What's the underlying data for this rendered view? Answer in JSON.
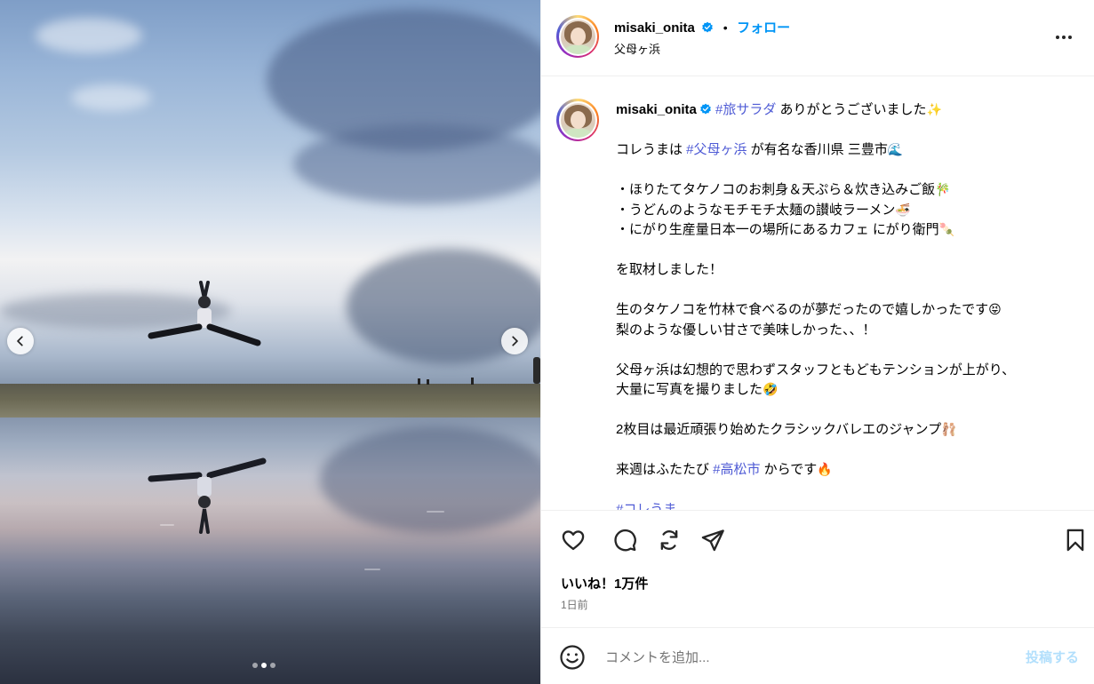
{
  "media": {
    "current_slide": 2,
    "total_slides": 3
  },
  "header": {
    "username": "misaki_onita",
    "separator": "•",
    "follow_label": "フォロー",
    "location": "父母ヶ浜",
    "more_icon": "more-horizontal-icon"
  },
  "caption": {
    "username": "misaki_onita",
    "tag_1": "#旅サラダ",
    "line_1_rest": " ありがとうございました",
    "emoji_1": "✨",
    "line_2_pre": "コレうまは ",
    "tag_2": "#父母ヶ浜",
    "line_2_post": " が有名な香川県 三豊市",
    "emoji_2": "🌊",
    "bullet_1": "・ほりたてタケノコのお刺身＆天ぷら＆炊き込みご飯",
    "emoji_3": "🎋",
    "bullet_2": "・うどんのようなモチモチ太麺の讃岐ラーメン",
    "emoji_4": "🍜",
    "bullet_3": "・にがり生産量日本一の場所にあるカフェ にがり衛門",
    "emoji_5": "🍡",
    "line_6": "を取材しました！",
    "line_7": "生のタケノコを竹林で食べるのが夢だったので嬉しかったです",
    "emoji_6": "😝",
    "line_8": "梨のような優しい甘さで美味しかった、、！",
    "line_9": "父母ヶ浜は幻想的で思わずスタッフともどもテンションが上がり、",
    "line_10": "大量に写真を撮りました",
    "emoji_7": "🤣",
    "line_11": "2枚目は最近頑張り始めたクラシックバレエのジャンプ",
    "emoji_8": "🩰",
    "line_12_pre": "来週はふたたび ",
    "tag_3": "#高松市",
    "line_12_post": " からです",
    "emoji_9": "🔥",
    "tag_4": "#コレうま"
  },
  "actions": {
    "like_icon": "heart-icon",
    "comment_icon": "comment-icon",
    "repost_icon": "repost-icon",
    "share_icon": "share-icon",
    "save_icon": "bookmark-icon"
  },
  "likes_text": "いいね！1万件",
  "timestamp": "1日前",
  "comment_box": {
    "placeholder": "コメントを追加...",
    "post_label": "投稿する"
  },
  "colors": {
    "link": "#4f5bd5",
    "follow": "#0095f6",
    "post_disabled": "#b2dffc",
    "verified": "#0095f6"
  }
}
